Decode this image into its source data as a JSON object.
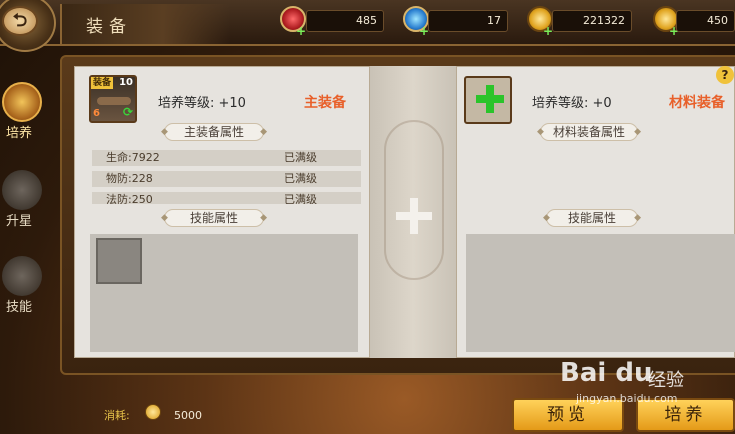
{
  "title": "装备",
  "resources": [
    {
      "icon": "red-gem-icon",
      "value": "485"
    },
    {
      "icon": "blue-gem-icon",
      "value": "17"
    },
    {
      "icon": "gold-coin-icon",
      "value": "221322"
    },
    {
      "icon": "gold-coin-icon",
      "value": "450"
    }
  ],
  "nav": [
    {
      "label": "培养",
      "icon": "star-icon",
      "active": true
    },
    {
      "label": "升星",
      "icon": "character-icon",
      "active": false
    },
    {
      "label": "技能",
      "icon": "skill-icon",
      "active": false
    }
  ],
  "main_equip": {
    "tag": "装备",
    "level_badge": "10",
    "quality_badge": "6",
    "level_label": "培养等级: +10",
    "role": "主装备",
    "attr_header": "主装备属性",
    "attrs": [
      {
        "name": "生命:7922",
        "status": "已满级"
      },
      {
        "name": "物防:228",
        "status": "已满级"
      },
      {
        "name": "法防:250",
        "status": "已满级"
      }
    ],
    "skill_header": "技能属性"
  },
  "material_equip": {
    "level_label": "培养等级: +0",
    "role": "材料装备",
    "attr_header": "材料装备属性",
    "skill_header": "技能属性"
  },
  "help": "?",
  "cost": {
    "label": "消耗:",
    "value": "5000"
  },
  "buttons": {
    "preview": "预览",
    "train": "培养"
  },
  "watermark": {
    "brand": "Bai du",
    "site": "jingyan.baidu.com",
    "text": "经验"
  },
  "colors": {
    "accent_orange": "#e8602a",
    "gold": "#f0c23a",
    "plus_green": "#2bc42b"
  }
}
